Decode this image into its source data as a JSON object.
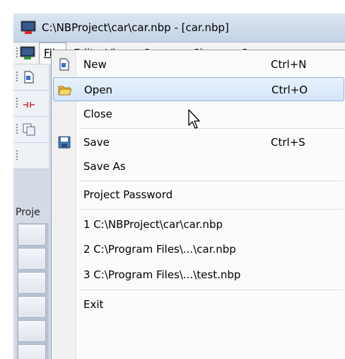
{
  "window": {
    "title": "C:\\NBProject\\car\\car.nbp - [car.nbp]"
  },
  "menubar": {
    "menus": [
      {
        "label": "File"
      },
      {
        "label": "Edit"
      },
      {
        "label": "View"
      },
      {
        "label": "Screen"
      },
      {
        "label": "Shape"
      },
      {
        "label": "Co"
      }
    ]
  },
  "sidepanel": {
    "header": "Proje"
  },
  "file_menu": {
    "items": [
      {
        "label": "New",
        "shortcut": "Ctrl+N",
        "icon": "new-document-icon"
      },
      {
        "label": "Open",
        "shortcut": "Ctrl+O",
        "icon": "open-folder-icon",
        "highlighted": true
      },
      {
        "label": "Close",
        "shortcut": ""
      },
      {
        "label": "Save",
        "shortcut": "Ctrl+S",
        "icon": "save-disk-icon"
      },
      {
        "label": "Save As",
        "shortcut": ""
      },
      {
        "label": "Project Password",
        "shortcut": ""
      },
      {
        "label": "1 C:\\NBProject\\car\\car.nbp",
        "shortcut": ""
      },
      {
        "label": "2 C:\\Program Files\\...\\car.nbp",
        "shortcut": ""
      },
      {
        "label": "3 C:\\Program Files\\...\\test.nbp",
        "shortcut": ""
      },
      {
        "label": "Exit",
        "shortcut": ""
      }
    ]
  },
  "colors": {
    "highlight_border": "#8eb3e0",
    "highlight_fill": "#d4e5f8",
    "titlebar": "#c3d2e5"
  }
}
